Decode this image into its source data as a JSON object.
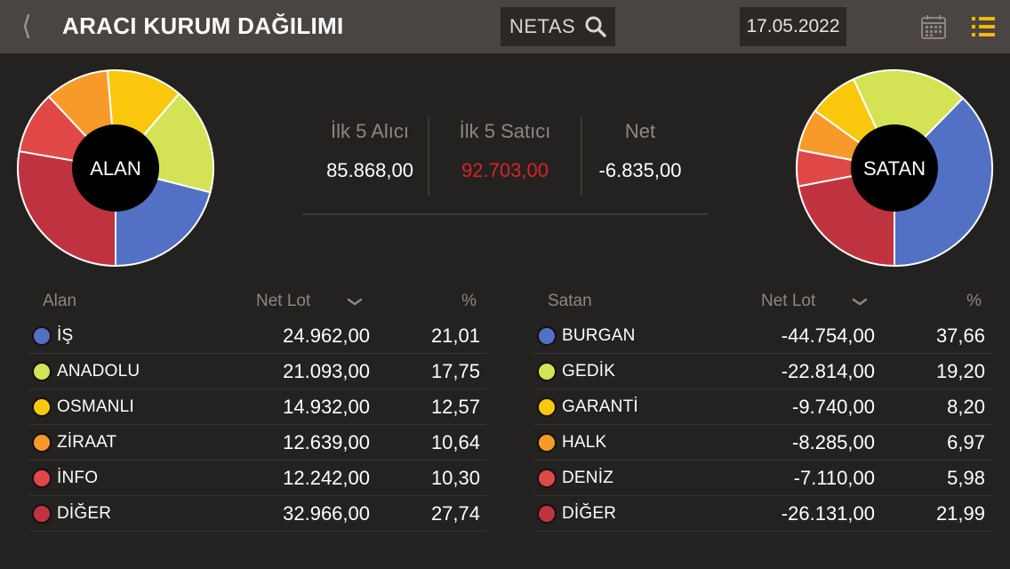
{
  "header": {
    "back_icon": "chevron-left-icon",
    "title": "ARACI KURUM DAĞILIMI",
    "symbol": "NETAS",
    "date": "17.05.2022",
    "calendar_icon": "calendar-icon",
    "menu_icon": "list-icon",
    "accent_color": "#f5b800"
  },
  "summary": {
    "buy_label": "İlk 5 Alıcı",
    "buy_value": "85.868,00",
    "sell_label": "İlk 5 Satıcı",
    "sell_value": "92.703,00",
    "net_label": "Net",
    "net_value": "-6.835,00"
  },
  "pies": {
    "left_label": "ALAN",
    "right_label": "SATAN"
  },
  "buyers": {
    "col_name": "Alan",
    "col_lot": "Net Lot",
    "col_pct": "%",
    "rows": [
      {
        "name": "İŞ",
        "lot": "24.962,00",
        "pct": "21,01",
        "share": 21.01,
        "color": "#5271c4"
      },
      {
        "name": "ANADOLU",
        "lot": "21.093,00",
        "pct": "17,75",
        "share": 17.75,
        "color": "#d4e355"
      },
      {
        "name": "OSMANLI",
        "lot": "14.932,00",
        "pct": "12,57",
        "share": 12.57,
        "color": "#f9c80c"
      },
      {
        "name": "ZİRAAT",
        "lot": "12.639,00",
        "pct": "10,64",
        "share": 10.64,
        "color": "#f79a2a"
      },
      {
        "name": "İNFO",
        "lot": "12.242,00",
        "pct": "10,30",
        "share": 10.3,
        "color": "#e04848"
      },
      {
        "name": "DİĞER",
        "lot": "32.966,00",
        "pct": "27,74",
        "share": 27.74,
        "color": "#bf3340"
      }
    ]
  },
  "sellers": {
    "col_name": "Satan",
    "col_lot": "Net Lot",
    "col_pct": "%",
    "rows": [
      {
        "name": "BURGAN",
        "lot": "-44.754,00",
        "pct": "37,66",
        "share": 37.66,
        "color": "#5271c4"
      },
      {
        "name": "GEDİK",
        "lot": "-22.814,00",
        "pct": "19,20",
        "share": 19.2,
        "color": "#d4e355"
      },
      {
        "name": "GARANTİ",
        "lot": "-9.740,00",
        "pct": "8,20",
        "share": 8.2,
        "color": "#f9c80c"
      },
      {
        "name": "HALK",
        "lot": "-8.285,00",
        "pct": "6,97",
        "share": 6.97,
        "color": "#f79a2a"
      },
      {
        "name": "DENİZ",
        "lot": "-7.110,00",
        "pct": "5,98",
        "share": 5.98,
        "color": "#e04848"
      },
      {
        "name": "DİĞER",
        "lot": "-26.131,00",
        "pct": "21,99",
        "share": 21.99,
        "color": "#bf3340"
      }
    ]
  }
}
